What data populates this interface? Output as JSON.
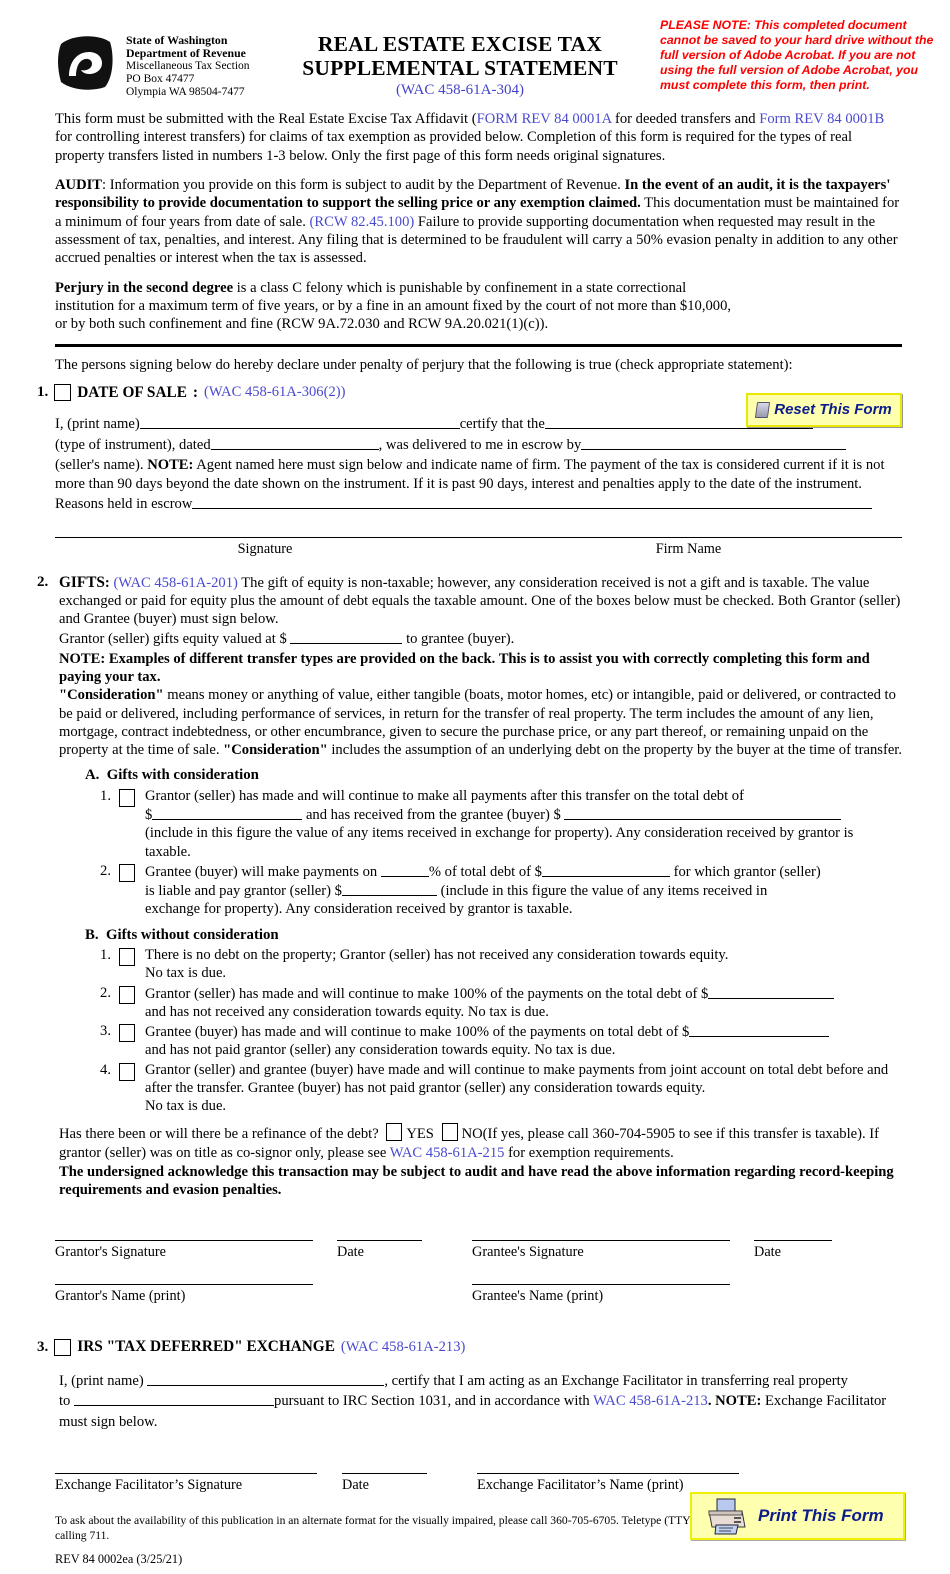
{
  "header": {
    "logo_icon": "dor-swirl-logo-icon",
    "agency_lines": [
      "State of Washington",
      "Department of Revenue",
      "Miscellaneous Tax Section",
      "PO Box 47477",
      "Olympia WA 98504-7477"
    ],
    "title_line1": "REAL ESTATE EXCISE TAX",
    "title_line2": "SUPPLEMENTAL STATEMENT",
    "title_wac": "(WAC 458-61A-304)",
    "please_note": "PLEASE NOTE: This completed document cannot be saved to your hard drive without the full version of Adobe Acrobat. If you are not using the full version of Adobe Acrobat, you must complete this form, then print."
  },
  "intro": {
    "p1_a": "This form must be submitted with the Real Estate Excise Tax Affidavit (",
    "p1_link1": "FORM REV 84 0001A",
    "p1_b": " for deeded transfers and ",
    "p1_link2": "Form REV 84 0001B",
    "p1_c": " for controlling interest transfers) for claims of tax exemption as provided below. Completion of this form is required for the types of real property transfers listed in numbers 1-3 below. Only the first page of this form needs original signatures.",
    "audit_label": "AUDIT",
    "audit_a": ": Information you provide on this form is subject to audit by the Department of Revenue. ",
    "audit_bold": "In the event of an audit, it is the taxpayers' responsibility to provide documentation to support the selling price or any exemption claimed.",
    "audit_b": " This documentation must be maintained for a minimum of four years from date of sale. ",
    "audit_link": "(RCW 82.45.100)",
    "audit_c": " Failure to provide supporting documentation when requested may result in the assessment of tax, penalties, and interest.   Any filing that is determined to be fraudulent will carry a 50% evasion penalty in addition to any other accrued penalties or interest when the tax is assessed.",
    "perjury_bold": "Perjury in the second degree",
    "perjury_text": " is a class C felony which is punishable by confinement in a state correctional institution for a maximum term of five years, or by a fine in an amount fixed by the court of not more than $10,000, or by both such confinement and fine (RCW 9A.72.030 and RCW 9A.20.021(1)(c)).",
    "declaration": "The persons signing below do hereby declare under penalty of perjury that the following is true (check appropriate statement):"
  },
  "reset_button": {
    "label": "Reset This Form",
    "icon": "eraser-icon"
  },
  "print_button": {
    "label": "Print This Form",
    "icon": "printer-icon"
  },
  "section1": {
    "number": "1.",
    "title": "DATE OF SALE",
    "title_colon": ":",
    "wac": "(WAC 458-61A-306(2))",
    "line1_a": "I, (print name)",
    "line1_b": "certify that the",
    "line2_a": "(type of instrument), dated",
    "line2_b": ", was delivered to me in escrow by",
    "line3_a": "(seller's name). ",
    "line3_note": "NOTE:",
    "line3_b": " Agent named here must sign below and indicate name of firm. The payment of the tax is considered current if it is not more than 90 days beyond the date shown on the instrument. If it is past 90 days, interest and penalties apply to the date of the instrument.",
    "line4": "Reasons held in escrow",
    "sig_label": "Signature",
    "firm_label": "Firm Name"
  },
  "section2": {
    "number": "2.",
    "title": "GIFTS",
    "title_colon": ":",
    "wac": "(WAC 458-61A-201)",
    "intro": " The gift of equity is non-taxable; however, any consideration received is not a gift and is taxable. The value exchanged or paid for equity plus the amount of debt equals the taxable amount. One of the boxes below must be checked. Both Grantor (seller) and Grantee (buyer) must sign below.",
    "equity_a": "Grantor (seller) gifts equity valued at $",
    "equity_b": "to grantee (buyer).",
    "note_bold": "NOTE: Examples of different transfer types are provided on the back. This is to assist you with correctly completing this form and paying your tax.",
    "consideration_q1": "\"Consideration\"",
    "consideration_a": " means money or anything of value, either tangible (boats, motor homes, etc) or intangible, paid or delivered, or contracted to be paid or delivered, including performance of services, in return for the transfer of real property. The term includes the amount of any lien, mortgage, contract indebtedness, or other encumbrance, given to secure the purchase price, or any part thereof, or remaining unpaid on the property at the time of sale. ",
    "consideration_q2": "\"Consideration\"",
    "consideration_b": " includes the assumption of an underlying debt on the property by the buyer at the time of transfer.",
    "group_a_label": "A.",
    "group_a_title": "Gifts with consideration",
    "a_items": [
      {
        "num": "1.",
        "t1": "Grantor (seller) has made and will continue to make all payments after this transfer on the total debt of",
        "t2_a": "$",
        "t2_b": "and has received from the grantee (buyer) $",
        "t3": "(include in this figure the value of any items received in exchange for property). Any consideration received by grantor is taxable."
      },
      {
        "num": "2.",
        "t1_a": "Grantee (buyer) will make payments on",
        "t1_b": "% of total debt of $",
        "t1_c": "for which grantor (seller)",
        "t2_a": "is liable and pay grantor (seller) $",
        "t2_b": "(include in this figure the value of any items received in",
        "t3": "exchange for property). Any consideration received by grantor is taxable."
      }
    ],
    "group_b_label": "B.",
    "group_b_title": "Gifts without consideration",
    "b_items": [
      {
        "num": "1.",
        "t1": "There is no debt on the property; Grantor (seller) has not received any consideration towards equity.",
        "t2": "No tax is due."
      },
      {
        "num": "2.",
        "t1": "Grantor (seller) has made and will continue to make 100% of the payments on the total debt of $",
        "t2": "and has not received any consideration towards equity. No tax is due."
      },
      {
        "num": "3.",
        "t1": "Grantee (buyer) has made and will continue to make 100% of the payments on total debt of $",
        "t2": "and has not paid grantor (seller) any consideration towards equity. No tax is due."
      },
      {
        "num": "4.",
        "t1": "Grantor (seller) and grantee (buyer) have made and will continue to make payments from joint account on total debt before and after the transfer. Grantee (buyer) has not paid grantor (seller) any consideration towards equity.",
        "t2": "No tax is due."
      }
    ],
    "refinance_q": "Has there been or will there be a refinance of the debt?",
    "yes_label": "YES",
    "no_label": "NO",
    "refinance_tail_a": "(If yes, please call 360-704-5905 to see if this transfer is taxable). If grantor (seller) was on title as co-signor only, please see ",
    "refinance_link": "WAC 458-61A-215",
    "refinance_tail_b": " for exemption requirements.",
    "undersigned_bold": "The undersigned acknowledge this transaction may be subject to audit and have read the above information regarding record-keeping requirements and evasion penalties.",
    "grantor_sig_label": "Grantor's Signature",
    "grantor_date_label": "Date",
    "grantee_sig_label": "Grantee's Signature",
    "grantee_date_label": "Date",
    "grantor_name_label": "Grantor's Name (print)",
    "grantee_name_label": "Grantee's Name (print)"
  },
  "section3": {
    "number": "3.",
    "title": "IRS \"TAX DEFERRED\" EXCHANGE",
    "wac": "(WAC 458-61A-213)",
    "line1_a": "I, (print name)",
    "line1_b": ", certify that I am acting as an Exchange Facilitator in transferring real property",
    "line2_a": "to",
    "line2_b": "pursuant to IRC Section 1031, and in accordance with ",
    "line2_link": "WAC 458-61A-213",
    "line2_note": ". NOTE:",
    "line2_c": " Exchange Facilitator must sign below.",
    "ef_sig_label": "Exchange Facilitator’s Signature",
    "ef_date_label": "Date",
    "ef_name_label": "Exchange Facilitator’s Name (print)"
  },
  "footer": {
    "accessibility": "To ask about the availability of this publication in an alternate format for the visually impaired, please call 360-705-6705. Teletype (TTY) users may use the WA Relay Service by calling 711.",
    "rev_id": "REV 84 0002ea (3/25/21)"
  },
  "colors": {
    "link_blue": "#4a4ad0",
    "note_red": "#ff0000",
    "button_yellow": "#ffffb0",
    "button_border": "#e8e800",
    "button_text": "#0b1c8c"
  }
}
